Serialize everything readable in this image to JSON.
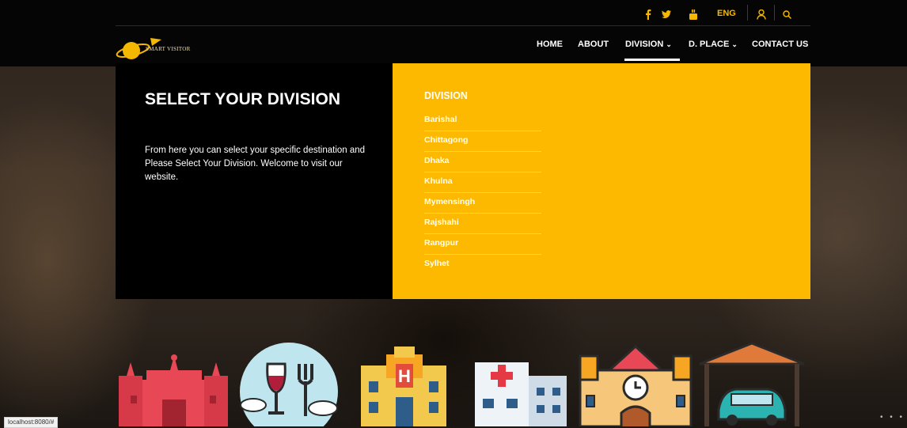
{
  "colors": {
    "accent": "#fdb900",
    "topbar": "#060505",
    "nav_text": "#ffffff"
  },
  "social": {
    "facebook": "f",
    "twitter": "twitter-bird-icon",
    "youtube": "youtube-icon",
    "language": "ENG",
    "user": "user-icon",
    "search": "search-icon"
  },
  "logo": {
    "text": "SMART VISITOR"
  },
  "nav": {
    "home": "HOME",
    "about": "ABOUT",
    "division": "DIVISION",
    "dplace": "D. PLACE",
    "contact": "CONTACT US"
  },
  "mega": {
    "title": "SELECT YOUR DIVISION",
    "description": "From here you can select your specific destination and Please Select Your Division. Welcome to visit our website.",
    "division_heading": "DIVISION",
    "divisions": [
      "Barishal",
      "Chittagong",
      "Dhaka",
      "Khulna",
      "Mymensingh",
      "Rajshahi",
      "Rangpur",
      "Sylhet"
    ]
  },
  "status_bar": {
    "url": "localhost:8080/#"
  },
  "category_icons": [
    "fort-icon",
    "restaurant-icon",
    "hotel-icon",
    "hospital-icon",
    "museum-icon",
    "parking-icon"
  ]
}
